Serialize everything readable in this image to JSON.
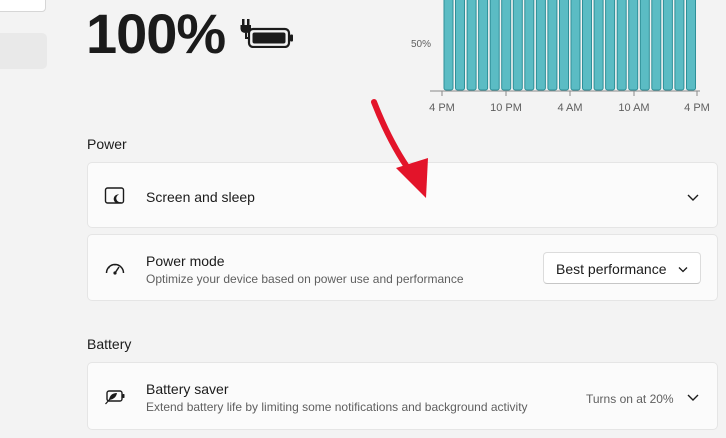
{
  "battery": {
    "percentage": "100%",
    "charge_level": 100
  },
  "usage_chart": {
    "y_tick": "50%",
    "x_ticks": [
      "4 PM",
      "10 PM",
      "4 AM",
      "10 AM",
      "4 PM"
    ],
    "bar_count": 22,
    "bar_color": "#5bbcc4",
    "bar_edge_color": "#2f8f98"
  },
  "power": {
    "section_title": "Power",
    "screen_sleep": {
      "title": "Screen and sleep"
    },
    "power_mode": {
      "title": "Power mode",
      "subtitle": "Optimize your device based on power use and performance",
      "selected": "Best performance"
    }
  },
  "battery_section": {
    "section_title": "Battery",
    "battery_saver": {
      "title": "Battery saver",
      "subtitle": "Extend battery life by limiting some notifications and background activity",
      "status": "Turns on at 20%"
    }
  },
  "annotation": {
    "arrow_color": "#e3142a"
  }
}
